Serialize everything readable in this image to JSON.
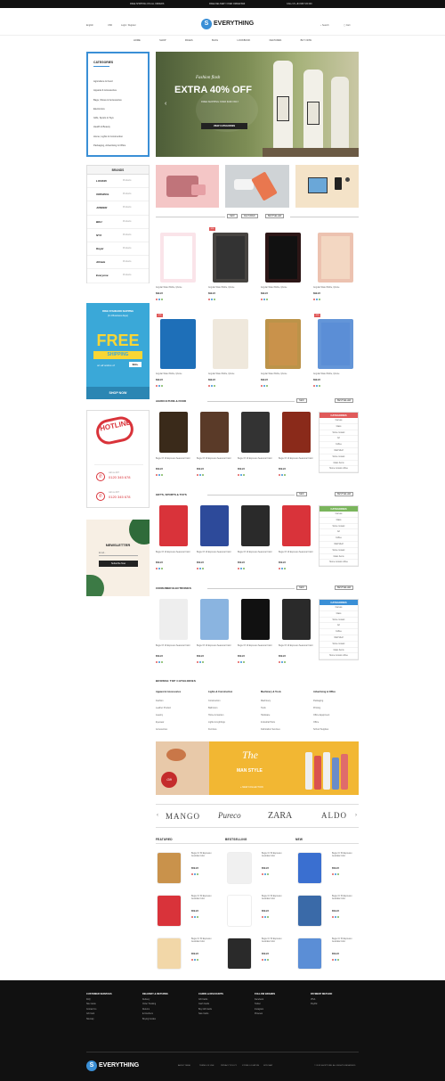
{
  "topbar": {
    "promo1": "FREE SHIPPING ON ALL ORDERS",
    "promo2": "FREE DELIVERY OVER ORDER $99",
    "promo3": "CALL US +84 908 726 000"
  },
  "header": {
    "lang": "English",
    "currency": "USD",
    "login": "Login / Register",
    "logo_text": "EVERYTHING",
    "search": "Search",
    "cart": "Cart"
  },
  "nav": [
    "HOME",
    "SHOP",
    "PAGES",
    "BLOG",
    "LOOKBOOK",
    "FEATURES",
    "BUY NOW"
  ],
  "categories": {
    "title": "CATEGORIES",
    "items": [
      "Agriculture & Food",
      "Apparel & Accessories",
      "Bags, Shoes & Accessories",
      "Electronics",
      "Gifts, Sports & Toys",
      "Health & Beauty",
      "Home, Lights & Construction",
      "Packaging, Advertising & Office"
    ]
  },
  "hero": {
    "tagline": "Fashion flash",
    "headline": "EXTRA 40% OFF",
    "sub": "FREE SHIPPING OVER $199 ONLY",
    "cta": "VIEW CATEGORIES"
  },
  "brands": {
    "title": "BRANDS",
    "items": [
      {
        "logo": "LOOKIN",
        "count": "Products"
      },
      {
        "logo": "ORIGINAL",
        "count": "Products"
      },
      {
        "logo": "JUNKER",
        "count": "Products"
      },
      {
        "logo": "BDU",
        "count": "Products"
      },
      {
        "logo": "NYX",
        "count": "Products"
      },
      {
        "logo": "Royal",
        "count": "Products"
      },
      {
        "logo": "Athlete",
        "count": "Products"
      },
      {
        "logo": "Everyone",
        "count": "Products"
      }
    ]
  },
  "banner_free": {
    "top": "FREE STANDARD SHIPPING",
    "sub": "(3-4 Business days)",
    "big1": "FREE",
    "big2": "SHIPPING",
    "on": "on all orders of",
    "amount": "$99+",
    "cta": "SHOP NOW"
  },
  "banner_hotline": {
    "title": "HOTLINE",
    "phone_label1": "call us 24/7",
    "phone1": "0120 345 678",
    "phone_label2": "call us 24/7",
    "phone2": "0120 345 678"
  },
  "newsletter": {
    "title": "NEWSLETTER",
    "placeholder": "Email...",
    "button": "Subscribe Now"
  },
  "tabs": [
    "NEW",
    "FEATURED",
    "BESTSELLER"
  ],
  "products_grid": [
    {
      "name": "Angular Water Bottle, Iphone",
      "price": "$99.22",
      "badge": ""
    },
    {
      "name": "Angular Water Bottle, Iphone",
      "price": "$99.22",
      "badge": "-6%"
    },
    {
      "name": "Angular Water Bottle, Iphone",
      "price": "$99.22",
      "badge": ""
    },
    {
      "name": "Angular Water Bottle, Iphone",
      "price": "$99.22",
      "badge": ""
    },
    {
      "name": "Angular Water Bottle, Iphone",
      "price": "$99.22",
      "badge": "-6%"
    },
    {
      "name": "Angular Water Bottle, Iphone",
      "price": "$99.22",
      "badge": ""
    },
    {
      "name": "Angular Water Bottle, Iphone",
      "price": "$99.22",
      "badge": ""
    },
    {
      "name": "Angular Water Bottle, Iphone",
      "price": "$99.22",
      "badge": "-6%"
    }
  ],
  "section_agri": {
    "title": "AGRICULTURE & FOOD",
    "tab1": "NEW",
    "tab2": "BESTSELLER",
    "products": [
      {
        "name": "Bugie Of 10 Espresso Seasonal Color",
        "price": "$59.22"
      },
      {
        "name": "Bugie Of 10 Espresso Seasonal Color",
        "price": "$59.22"
      },
      {
        "name": "Bugie Of 10 Espresso Seasonal Color",
        "price": "$59.22"
      },
      {
        "name": "Bugie Of 10 Espresso Seasonal Color",
        "price": "$59.22"
      }
    ],
    "cats": [
      "Canvas",
      "Glass",
      "Stone mosaic",
      "Art",
      "Coffee",
      "Wall Shelf",
      "Stone mosaic",
      "Glass Items",
      "Stone mosaic coffee"
    ]
  },
  "section_gifts": {
    "title": "GIFTS, SPORTS & TOYS",
    "tab1": "NEW",
    "tab2": "BESTSELLER",
    "products": [
      {
        "name": "Bugie Of 10 Espresso Seasonal Color",
        "price": "$59.22"
      },
      {
        "name": "Bugie Of 10 Espresso Seasonal Color",
        "price": "$59.22"
      },
      {
        "name": "Bugie Of 10 Espresso Seasonal Color",
        "price": "$59.22"
      },
      {
        "name": "Bugie Of 10 Espresso Seasonal Color",
        "price": "$59.22"
      }
    ],
    "cats": [
      "Canvas",
      "Glass",
      "Stone mosaic",
      "Art",
      "Coffee",
      "Wall Shelf",
      "Stone mosaic",
      "Glass Items",
      "Stone mosaic coffee"
    ]
  },
  "section_elec": {
    "title": "CONSUMER ELECTRONICS",
    "tab1": "NEW",
    "tab2": "BESTSELLER",
    "products": [
      {
        "name": "Bugie Of 10 Espresso Seasonal Color",
        "price": "$59.22"
      },
      {
        "name": "Bugie Of 10 Espresso Seasonal Color",
        "price": "$59.22"
      },
      {
        "name": "Bugie Of 10 Espresso Seasonal Color",
        "price": "$59.22"
      },
      {
        "name": "Bugie Of 10 Espresso Seasonal Color",
        "price": "$59.22"
      }
    ],
    "cats": [
      "Canvas",
      "Glass",
      "Stone mosaic",
      "Art",
      "Coffee",
      "Wall Shelf",
      "Stone mosaic",
      "Glass Items",
      "Stone mosaic coffee"
    ]
  },
  "cats_header": "CATEGORIES",
  "browse": {
    "title": "BROWSE TOP CATEGORIES",
    "cols": [
      {
        "head": "Apparel & Accessories",
        "items": [
          "Fashion",
          "Leather Product",
          "Jewelry",
          "Eyewear",
          "Accessories"
        ]
      },
      {
        "head": "Lights & Construction",
        "items": [
          "Construction",
          "Bathroom",
          "Home & Garden",
          "Lights & Lightings",
          "Furniture"
        ]
      },
      {
        "head": "Machinery & Tools",
        "items": [
          "Machinery",
          "Tools",
          "Hardware",
          "Industrial Parts",
          "Fabrication Services"
        ]
      },
      {
        "head": "Advertising & Office",
        "items": [
          "Packaging",
          "Printing",
          "Office Equipment",
          "Office",
          "School Supplies"
        ]
      }
    ]
  },
  "man_banner": {
    "gift": "Gift",
    "the": "The",
    "man_style": "MAN STYLE",
    "cta": "+ NEW COLLECTION"
  },
  "brand_strip": [
    "MANGO",
    "Pureco",
    "ZARA",
    "ALDO"
  ],
  "lists": {
    "featured": "FEATURED",
    "bestselling": "BESTSELLING",
    "new": "NEW",
    "item_name": "Bugie Or 50 Espresso Australia Color",
    "item_price": "$59.22"
  },
  "footer": {
    "cols": [
      {
        "head": "CUSTOMER SERVICES",
        "items": [
          "FAQ",
          "Site Guide",
          "Contact Us",
          "Gift Card",
          "Sitemap"
        ]
      },
      {
        "head": "DELIVERY & RETURNS",
        "items": [
          "Delivery",
          "Order Tracking",
          "Returns",
          "E-Vouchers",
          "Buying Guides"
        ]
      },
      {
        "head": "CARDS & DISCOUNTS",
        "items": [
          "Gift Cards",
          "Cash Cards",
          "Buy Gift Cards",
          "Sale Cards"
        ]
      },
      {
        "head": "FOLLOW BRANDS",
        "items": [
          "Facebook",
          "Twitter",
          "Instagram",
          "Pinterest"
        ]
      },
      {
        "head": "PAYMENT METHOD",
        "items": [
          "VISA",
          "PayPal"
        ]
      }
    ],
    "logo_text": "EVERYTHING",
    "links": [
      "ABOUT PAGE",
      "TERMS OF USE",
      "PRIVACY POLICY",
      "STORE LOCATION",
      "SITE MAP"
    ],
    "copyright": "© 2019 SHOPTORE. ALL RIGHTS RESERVED"
  },
  "colors": {
    "accent": "#3a8fd6",
    "red": "#e05a5a",
    "green": "#7ab55c",
    "yellow": "#f2c21a",
    "dark": "#111111"
  }
}
